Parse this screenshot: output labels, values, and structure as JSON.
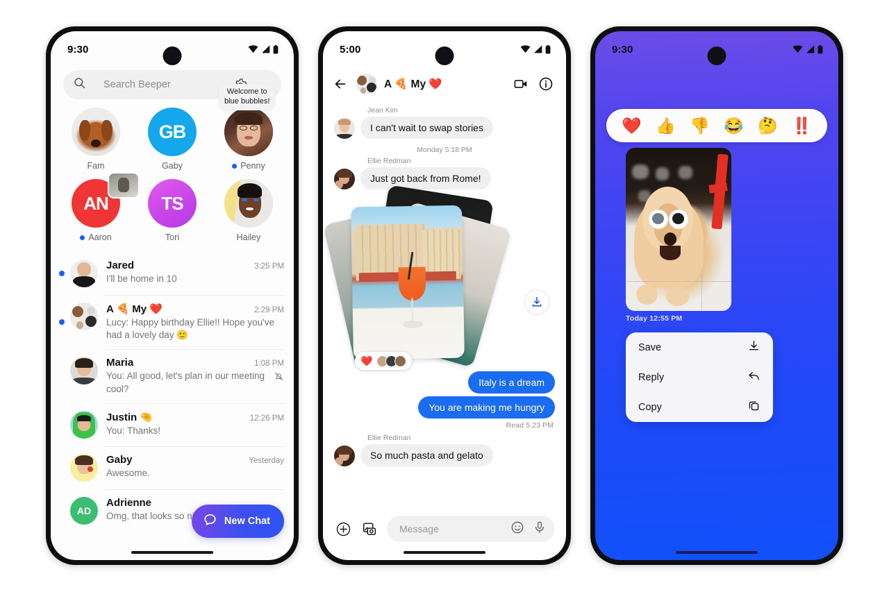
{
  "app": {
    "name": "Beeper",
    "accent": "#1a6cf0",
    "brand_gradient_start": "#7a46e8",
    "brand_gradient_end": "#2b53f5"
  },
  "phone1": {
    "status": {
      "time": "9:30",
      "icons": [
        "wifi-icon",
        "cellular-icon",
        "battery-icon"
      ]
    },
    "search": {
      "placeholder": "Search Beeper",
      "search_icon": "search-icon",
      "settings_icon": "gear-icon",
      "avatar": "profile-avatar"
    },
    "pins": [
      {
        "name": "Fam",
        "type": "photo",
        "unread": false,
        "tooltip": ""
      },
      {
        "name": "Gaby",
        "type": "logo",
        "initials": "GB",
        "color": "#14a7ec",
        "unread": false,
        "tooltip": ""
      },
      {
        "name": "Penny",
        "type": "photo",
        "unread": true,
        "tooltip": "Welcome to\nblue bubbles!"
      },
      {
        "name": "Aaron",
        "type": "initials",
        "initials": "AN",
        "color": "#ef3535",
        "unread": true,
        "tooltip": ""
      },
      {
        "name": "Tori",
        "type": "initials",
        "initials": "TS",
        "color": "#d846e8",
        "unread": false,
        "tooltip": ""
      },
      {
        "name": "Hailey",
        "type": "photo",
        "unread": false,
        "tooltip": ""
      }
    ],
    "chats": [
      {
        "name": "Jared",
        "emoji": "",
        "time": "3:25 PM",
        "preview": "I'll be home in 10",
        "unread": true,
        "muted": false,
        "avatar_kind": "photo"
      },
      {
        "name": "A 🍕 My ❤️",
        "emoji": "",
        "time": "2:29 PM",
        "preview": "Lucy: Happy birthday Ellie!! Hope you've had a lovely day  🙂",
        "unread": true,
        "muted": false,
        "avatar_kind": "group"
      },
      {
        "name": "Maria",
        "emoji": "",
        "time": "1:08 PM",
        "preview": "You: All good, let's plan in our meeting cool?",
        "unread": false,
        "muted": true,
        "avatar_kind": "photo"
      },
      {
        "name": "Justin 🤏",
        "emoji": "",
        "time": "12:26 PM",
        "preview": "You: Thanks!",
        "unread": false,
        "muted": false,
        "avatar_kind": "photo"
      },
      {
        "name": "Gaby",
        "emoji": "",
        "time": "Yesterday",
        "preview": "Awesome.",
        "unread": false,
        "muted": false,
        "avatar_kind": "photo"
      },
      {
        "name": "Adrienne",
        "emoji": "",
        "time": "",
        "preview": "Omg, that looks so nice!",
        "unread": false,
        "muted": false,
        "avatar_kind": "initials",
        "initials": "AD",
        "avatar_color": "#3bbd72"
      }
    ],
    "fab": {
      "label": "New Chat",
      "icon": "chat-bubble-icon"
    }
  },
  "phone2": {
    "status": {
      "time": "5:00"
    },
    "header": {
      "back_icon": "back-arrow-icon",
      "title": "A 🍕 My ❤️",
      "video_icon": "video-camera-icon",
      "info_icon": "info-icon"
    },
    "messages": [
      {
        "kind": "incoming",
        "sender": "Jean Kim",
        "text": "I can't wait to swap stories"
      },
      {
        "kind": "daystamp",
        "text": "Monday 5:18 PM"
      },
      {
        "kind": "incoming",
        "sender": "Ellie Redman",
        "text": "Just got back from Rome!"
      },
      {
        "kind": "photos",
        "sender": "",
        "reaction": "❤️",
        "download_icon": "download-icon"
      },
      {
        "kind": "outgoing",
        "text": "Italy is a dream"
      },
      {
        "kind": "outgoing",
        "text": "You are making me hungry"
      },
      {
        "kind": "readstamp",
        "text": "Read  5:23 PM"
      },
      {
        "kind": "incoming",
        "sender": "Ellie Redman",
        "text": "So much pasta and gelato"
      }
    ],
    "composer": {
      "plus_icon": "plus-circle-icon",
      "gallery_icon": "photo-gallery-icon",
      "placeholder": "Message",
      "emoji_icon": "emoji-smiley-icon",
      "mic_icon": "microphone-icon"
    }
  },
  "phone3": {
    "status": {
      "time": "9:30"
    },
    "reactions": [
      "❤️",
      "👍",
      "👎",
      "😂",
      "🤔",
      "‼️"
    ],
    "reaction_names": [
      "heart-reaction",
      "thumbs-up-reaction",
      "thumbs-down-reaction",
      "laughing-reaction",
      "thinking-reaction",
      "exclamation-reaction"
    ],
    "photo_timestamp": "Today  12:55 PM",
    "menu": [
      {
        "label": "Save",
        "icon": "download-icon"
      },
      {
        "label": "Reply",
        "icon": "reply-arrow-icon"
      },
      {
        "label": "Copy",
        "icon": "copy-icon"
      }
    ]
  }
}
